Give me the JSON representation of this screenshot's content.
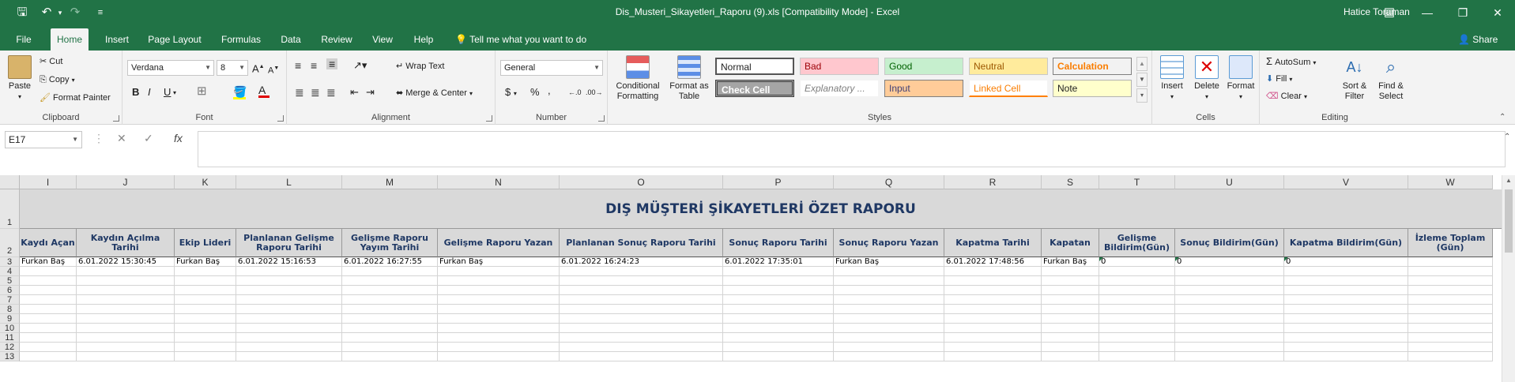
{
  "titlebar": {
    "title": "Dis_Musteri_Sikayetleri_Raporu (9).xls  [Compatibility Mode]  -  Excel",
    "user": "Hatice Toraman"
  },
  "tabs": [
    "File",
    "Home",
    "Insert",
    "Page Layout",
    "Formulas",
    "Data",
    "Review",
    "View",
    "Help"
  ],
  "tell_me": "Tell me what you want to do",
  "share": "Share",
  "ribbon": {
    "clipboard": {
      "label": "Clipboard",
      "paste": "Paste",
      "cut": "Cut",
      "copy": "Copy",
      "format_painter": "Format Painter"
    },
    "font": {
      "label": "Font",
      "name": "Verdana",
      "size": "8",
      "bold": "B",
      "italic": "I",
      "underline": "U"
    },
    "alignment": {
      "label": "Alignment",
      "wrap": "Wrap Text",
      "merge": "Merge & Center"
    },
    "number": {
      "label": "Number",
      "format": "General",
      "currency": "$",
      "percent": "%",
      "comma": ","
    },
    "styles": {
      "label": "Styles",
      "conditional": "Conditional Formatting",
      "format_as_table": "Format as Table",
      "cells": [
        "Normal",
        "Bad",
        "Good",
        "Neutral",
        "Calculation",
        "Check Cell",
        "Explanatory ...",
        "Input",
        "Linked Cell",
        "Note"
      ]
    },
    "cells": {
      "label": "Cells",
      "insert": "Insert",
      "delete": "Delete",
      "format": "Format"
    },
    "editing": {
      "label": "Editing",
      "autosum": "AutoSum",
      "fill": "Fill",
      "clear": "Clear",
      "sort": "Sort & Filter",
      "find": "Find & Select"
    }
  },
  "formula_bar": {
    "name_box": "E17",
    "fx": "fx",
    "content": ""
  },
  "sheet": {
    "columns": [
      "I",
      "J",
      "K",
      "L",
      "M",
      "N",
      "O",
      "P",
      "Q",
      "R",
      "S",
      "T",
      "U",
      "V",
      "W"
    ],
    "rows": [
      "1",
      "2",
      "3",
      "4",
      "5",
      "6",
      "7",
      "8",
      "9",
      "10",
      "11",
      "12",
      "13"
    ],
    "title": "DIŞ MÜŞTERİ ŞİKAYETLERİ ÖZET RAPORU",
    "headers": [
      "Kaydı Açan",
      "Kaydın Açılma Tarihi",
      "Ekip Lideri",
      "Planlanan Gelişme Raporu Tarihi",
      "Gelişme Raporu Yayım Tarihi",
      "Gelişme Raporu Yazan",
      "Planlanan Sonuç Raporu Tarihi",
      "Sonuç Raporu Tarihi",
      "Sonuç Raporu Yazan",
      "Kapatma Tarihi",
      "Kapatan",
      "Gelişme Bildirim(Gün)",
      "Sonuç Bildirim(Gün)",
      "Kapatma Bildirim(Gün)",
      "İzleme Toplam (Gün)"
    ],
    "data_row": [
      "Furkan Baş",
      "6.01.2022 15:30:45",
      "Furkan Baş",
      "6.01.2022 15:16:53",
      "6.01.2022 16:27:55",
      "Furkan Baş",
      "6.01.2022 16:24:23",
      "6.01.2022 17:35:01",
      "Furkan Baş",
      "6.01.2022 17:48:56",
      "Furkan Baş",
      "0",
      "0",
      "0",
      ""
    ]
  }
}
